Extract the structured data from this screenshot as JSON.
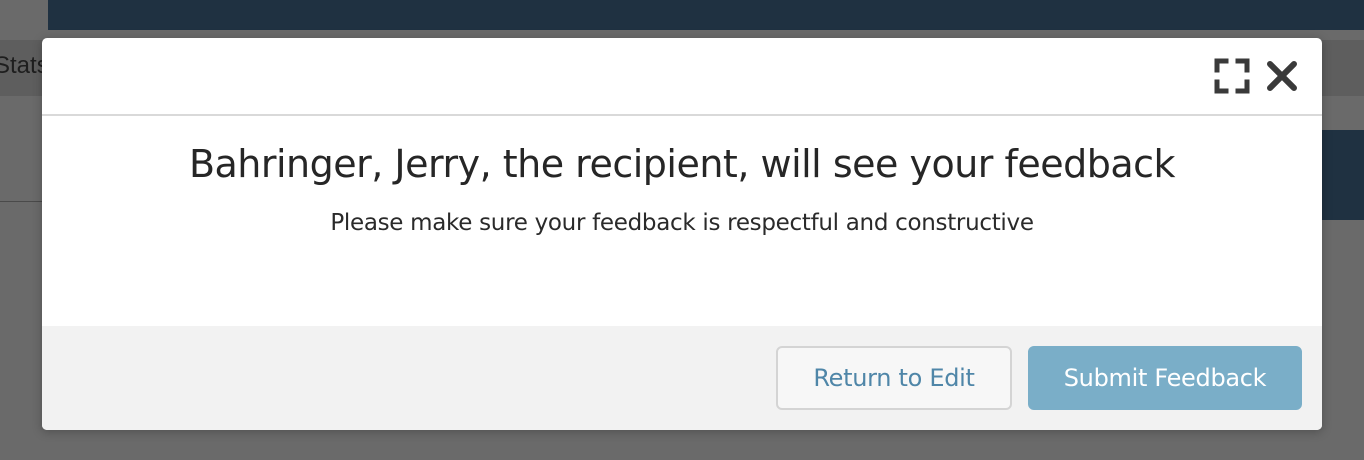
{
  "background": {
    "tab_label": "Stats"
  },
  "modal": {
    "title": "Bahringer, Jerry, the recipient, will see your feedback",
    "subtitle": "Please make sure your feedback is respectful and constructive",
    "icons": {
      "expand": "expand-icon",
      "close": "close-icon"
    },
    "buttons": {
      "return_label": "Return to Edit",
      "submit_label": "Submit Feedback"
    }
  },
  "colors": {
    "primary": "#7aaec8",
    "link": "#4f86a8",
    "topbar": "#1f3141"
  }
}
